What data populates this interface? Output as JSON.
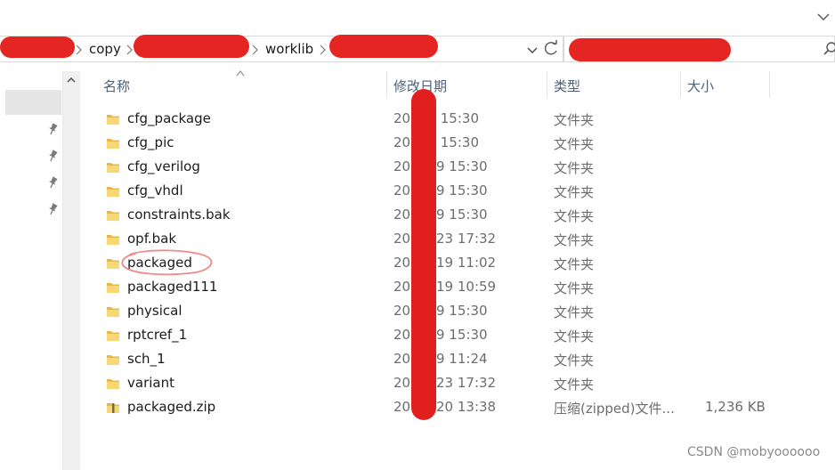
{
  "address": {
    "crumbs": [
      "copy",
      "worklib"
    ]
  },
  "columns": {
    "name": "名称",
    "date": "修改日期",
    "type": "类型",
    "size": "大小"
  },
  "files": [
    {
      "name": "cfg_package",
      "date": "20 1/9 15:30",
      "type": "文件夹",
      "size": "",
      "icon": "folder-icon"
    },
    {
      "name": "cfg_pic",
      "date": "20 1/9 15:30",
      "type": "文件夹",
      "size": "",
      "icon": "folder-icon"
    },
    {
      "name": "cfg_verilog",
      "date": "202 1/9 15:30",
      "type": "文件夹",
      "size": "",
      "icon": "folder-icon"
    },
    {
      "name": "cfg_vhdl",
      "date": "202 1/9 15:30",
      "type": "文件夹",
      "size": "",
      "icon": "folder-icon"
    },
    {
      "name": "constraints.bak",
      "date": "202 1/9 15:30",
      "type": "文件夹",
      "size": "",
      "icon": "folder-icon"
    },
    {
      "name": "opf.bak",
      "date": "201 2/23 17:32",
      "type": "文件夹",
      "size": "",
      "icon": "folder-icon"
    },
    {
      "name": "packaged",
      "date": "202 1/19 11:02",
      "type": "文件夹",
      "size": "",
      "icon": "folder-icon"
    },
    {
      "name": "packaged111",
      "date": "202 1/19 10:59",
      "type": "文件夹",
      "size": "",
      "icon": "folder-icon"
    },
    {
      "name": "physical",
      "date": "202 1/9 15:30",
      "type": "文件夹",
      "size": "",
      "icon": "folder-icon"
    },
    {
      "name": "rptcref_1",
      "date": "202 1/9 15:30",
      "type": "文件夹",
      "size": "",
      "icon": "folder-icon"
    },
    {
      "name": "sch_1",
      "date": "20 1/19 11:24",
      "type": "文件夹",
      "size": "",
      "icon": "folder-icon"
    },
    {
      "name": "variant",
      "date": "20 12/23 17:32",
      "type": "文件夹",
      "size": "",
      "icon": "folder-icon"
    },
    {
      "name": "packaged.zip",
      "date": "20 12/20 13:38",
      "type": "压缩(zipped)文件...",
      "size": "1,236 KB",
      "icon": "zip-folder-icon"
    }
  ],
  "watermark": "CSDN @mobyoooooo",
  "colors": {
    "redaction": "#e52521",
    "folder": "#f8d775",
    "header_text": "#4c607a",
    "annotation_circle": "#f08a8a"
  }
}
